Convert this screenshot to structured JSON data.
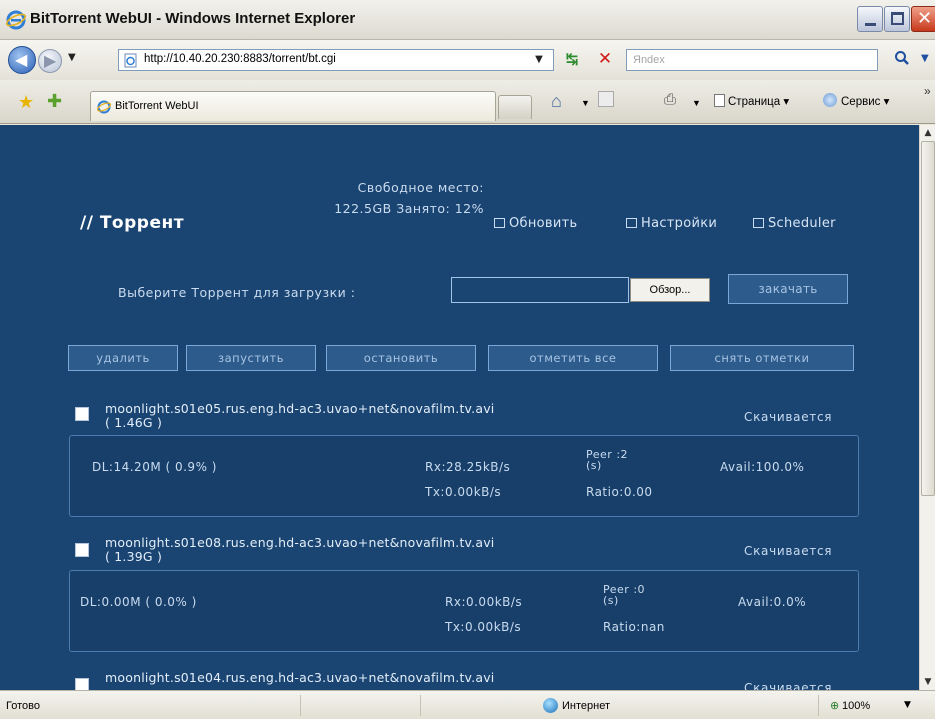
{
  "window": {
    "title": "BitTorrent WebUI - Windows Internet Explorer"
  },
  "address_bar": {
    "url": "http://10.40.20.230:8883/torrent/bt.cgi",
    "search_placeholder": "Яndex"
  },
  "tabs": [
    {
      "label": "BitTorrent WebUI"
    }
  ],
  "command_bar": {
    "page_label": "Страница",
    "tools_label": "Сервис"
  },
  "app": {
    "title": "// Торрент",
    "free_space": "Свободное место: 122.5GB Занято: 12%",
    "links": {
      "refresh": "Обновить",
      "settings": "Настройки",
      "scheduler": "Scheduler"
    },
    "upload": {
      "label": "Выберите Торрент для загрузки :",
      "browse": "Обзор...",
      "download": "закачать"
    },
    "actions": {
      "delete": "удалить",
      "start": "запустить",
      "stop": "остановить",
      "select_all": "отметить все",
      "deselect": "снять отметки"
    }
  },
  "torrents": [
    {
      "name": "moonlight.s01e05.rus.eng.hd-ac3.uvao+net&novafilm.tv.avi",
      "size": "( 1.46G )",
      "status": "Скачивается",
      "dl": "DL:14.20M ( 0.9% )",
      "rx": "Rx:28.25kB/s",
      "tx": "Tx:0.00kB/s",
      "peer_label": "Peer",
      "peer_suffix": "(s)",
      "peer_value": ":2",
      "ratio": "Ratio:0.00",
      "avail": "Avail:100.0%"
    },
    {
      "name": "moonlight.s01e08.rus.eng.hd-ac3.uvao+net&novafilm.tv.avi",
      "size": "( 1.39G )",
      "status": "Скачивается",
      "dl": "DL:0.00M ( 0.0% )",
      "rx": "Rx:0.00kB/s",
      "tx": "Tx:0.00kB/s",
      "peer_label": "Peer",
      "peer_suffix": "(s)",
      "peer_value": ":0",
      "ratio": "Ratio:nan",
      "avail": "Avail:0.0%"
    },
    {
      "name": "moonlight.s01e04.rus.eng.hd-ac3.uvao+net&novafilm.tv.avi",
      "status": "Скачивается"
    }
  ],
  "status_bar": {
    "text": "Готово",
    "zone": "Интернет",
    "zoom": "100%"
  },
  "colors": {
    "page_bg": "#1a4472",
    "button_bg": "#2c5b8c",
    "box_border": "#4c7bb0"
  },
  "icons": [
    "ie-logo-icon",
    "back-icon",
    "forward-icon",
    "refresh-icon",
    "stop-icon",
    "search-icon",
    "favorites-star-icon",
    "add-favorites-icon",
    "home-icon",
    "feeds-icon",
    "print-icon",
    "page-icon",
    "tools-icon",
    "globe-icon",
    "zoom-icon"
  ]
}
